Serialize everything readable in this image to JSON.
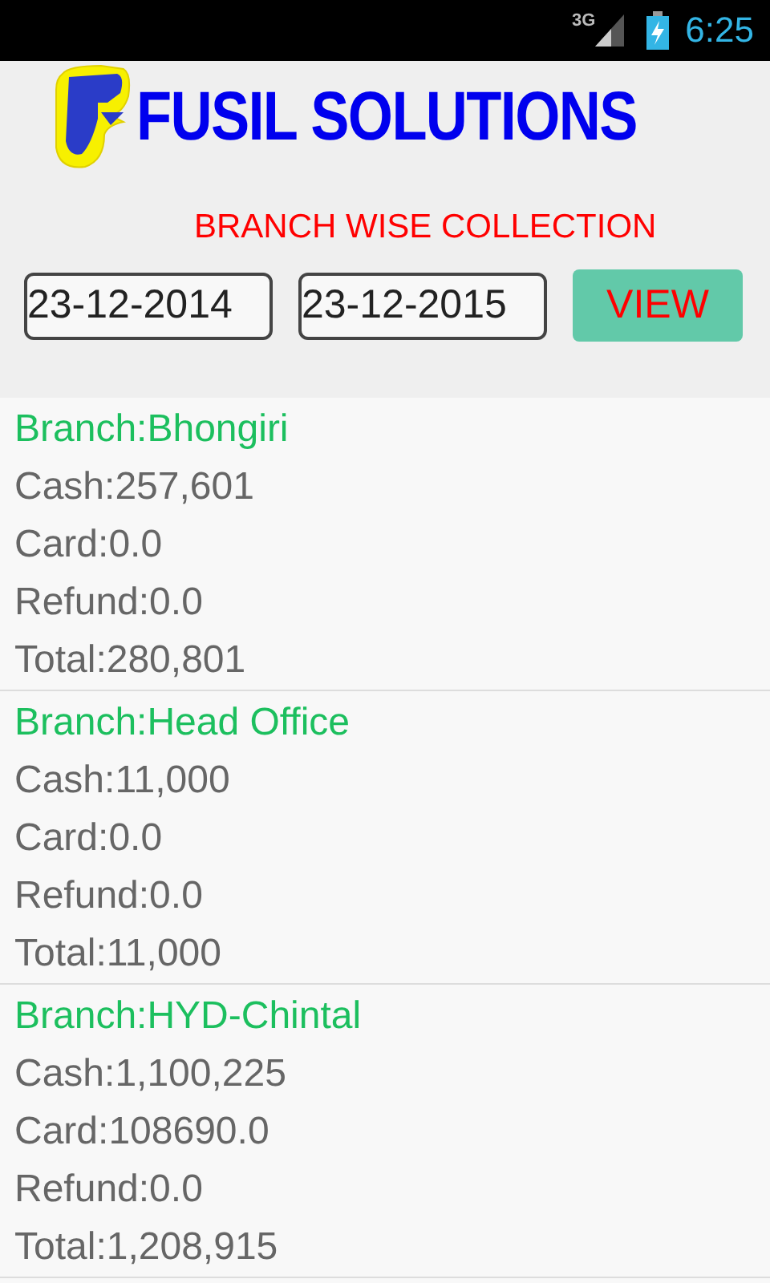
{
  "status_bar": {
    "network": "3G",
    "time": "6:25"
  },
  "header": {
    "title": "FUSIL SOLUTIONS",
    "subtitle": "BRANCH WISE COLLECTION"
  },
  "filters": {
    "from_date": "23-12-2014",
    "to_date": "23-12-2015",
    "button": "VIEW"
  },
  "branches": [
    {
      "branch": "Branch:Bhongiri",
      "lines": [
        "Cash:257,601",
        "Card:0.0",
        "Refund:0.0",
        "Total:280,801"
      ]
    },
    {
      "branch": "Branch:Head Office",
      "lines": [
        "Cash:11,000",
        "Card:0.0",
        "Refund:0.0",
        "Total:11,000"
      ]
    },
    {
      "branch": "Branch:HYD-Chintal",
      "lines": [
        "Cash:1,100,225",
        "Card:108690.0",
        "Refund:0.0",
        "Total:1,208,915"
      ]
    }
  ]
}
